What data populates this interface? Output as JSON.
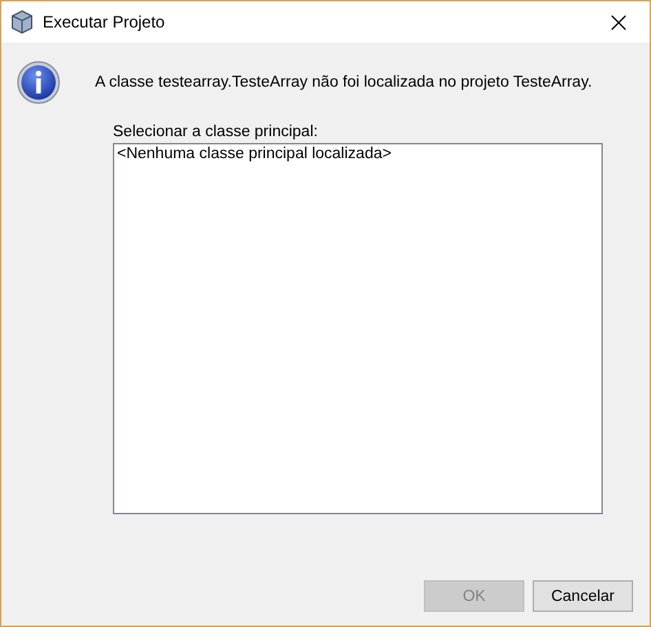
{
  "window": {
    "title": "Executar Projeto"
  },
  "message": "A classe testearray.TesteArray não foi localizada no projeto TesteArray.",
  "class_list": {
    "label": "Selecionar a classe principal:",
    "items": [
      "<Nenhuma classe principal localizada>"
    ]
  },
  "buttons": [
    {
      "label": "OK",
      "disabled": true
    },
    {
      "label": "Cancelar",
      "disabled": false
    }
  ]
}
